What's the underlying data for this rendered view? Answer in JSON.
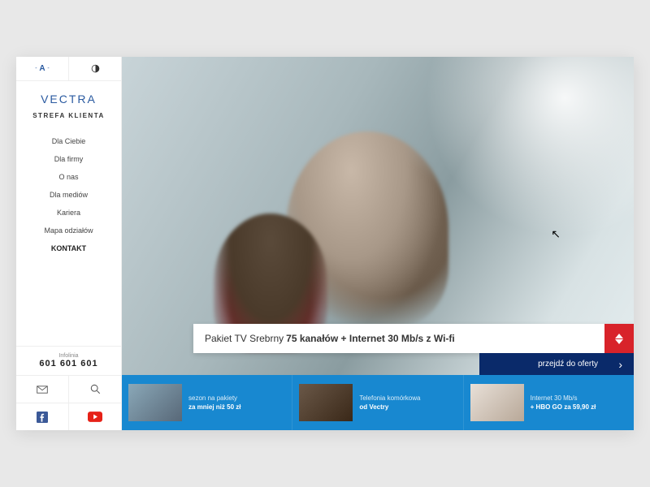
{
  "topbar": {
    "font_label": "A"
  },
  "brand": {
    "name": "VECTRA",
    "subheading": "STREFA KLIENTA"
  },
  "nav": {
    "items": [
      {
        "label": "Dla Ciebie",
        "bold": false
      },
      {
        "label": "Dla firmy",
        "bold": false
      },
      {
        "label": "O nas",
        "bold": false
      },
      {
        "label": "Dla mediów",
        "bold": false
      },
      {
        "label": "Kariera",
        "bold": false
      },
      {
        "label": "Mapa odziałów",
        "bold": false
      },
      {
        "label": "KONTAKT",
        "bold": true
      }
    ]
  },
  "helpline": {
    "label": "Infolinia",
    "number": "601 601 601"
  },
  "icons": {
    "mail": "mail-icon",
    "search": "search-icon",
    "facebook": "facebook-icon",
    "youtube": "youtube-icon",
    "contrast": "contrast-icon"
  },
  "offer": {
    "prefix": "Pakiet TV Srebrny",
    "bold": "75 kanałów + Internet 30 Mb/s z Wi-fi",
    "cta": "przejdź do oferty"
  },
  "tiles": [
    {
      "line1": "sezon na pakiety",
      "line2": "za mniej niż 50 zł"
    },
    {
      "line1": "Telefonia komórkowa",
      "line2": "od Vectry"
    },
    {
      "line1": "Internet 30 Mb/s",
      "line2": "+ HBO GO za 59,90 zł"
    }
  ],
  "colors": {
    "brand_blue": "#2a5aa0",
    "accent_red": "#d8232a",
    "cta_navy": "#0a2a6a",
    "tile_blue": "#1888d0"
  }
}
